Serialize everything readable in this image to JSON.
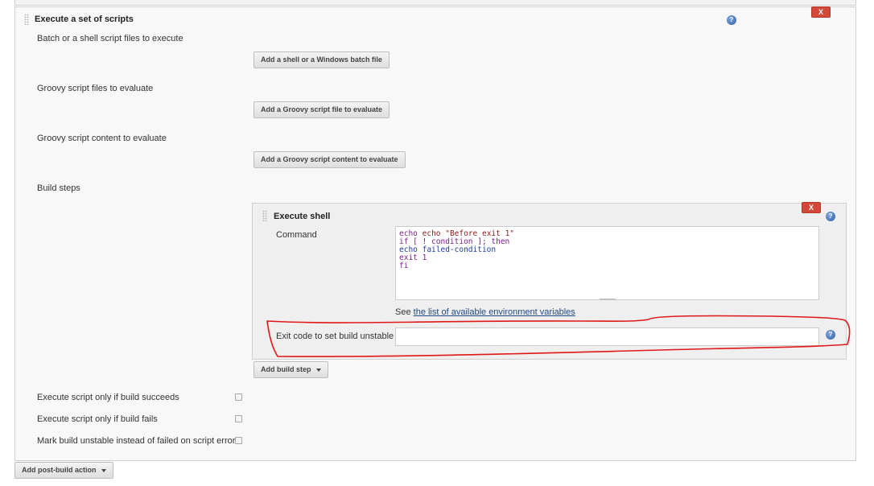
{
  "section": {
    "title": "Execute a set of scripts",
    "delete_label": "X"
  },
  "fields": {
    "batch_label": "Batch or a shell script files to execute",
    "batch_button": "Add a shell or a Windows batch file",
    "groovy_files_label": "Groovy script files to evaluate",
    "groovy_files_button": "Add a Groovy script file to evaluate",
    "groovy_content_label": "Groovy script content to evaluate",
    "groovy_content_button": "Add a Groovy script content to evaluate",
    "build_steps_label": "Build steps"
  },
  "shell_step": {
    "title": "Execute shell",
    "delete_label": "X",
    "command_label": "Command",
    "command_lines": [
      "echo \"Before exit 1\"",
      "if [ ! condition ]; then",
      "echo failed-condition",
      "exit 1",
      "fi"
    ],
    "env_prefix": "See ",
    "env_link": "the list of available environment variables",
    "exit_code_label": "Exit code to set build unstable",
    "exit_code_value": ""
  },
  "add_build_step": "Add build step",
  "options": {
    "succeeds_label": "Execute script only if build succeeds",
    "fails_label": "Execute script only if build fails",
    "unstable_label": "Mark build unstable instead of failed on script error"
  },
  "add_post_build": "Add post-build action",
  "icons": {
    "help": "help-icon",
    "drag": "drag-handle-icon",
    "dropdown": "caret-down-icon"
  },
  "colors": {
    "delete_button": "#d24939",
    "annotation": "#e01818",
    "link": "#204a87"
  }
}
